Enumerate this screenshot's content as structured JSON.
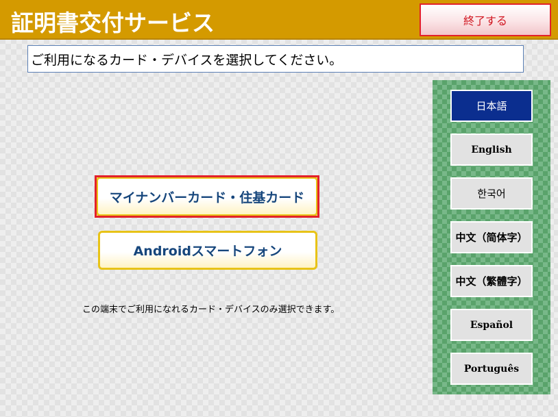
{
  "header": {
    "title": "証明書交付サービス",
    "exit_label": "終了する"
  },
  "instruction": "ご利用になるカード・デバイスを選択してください。",
  "devices": [
    {
      "label": "マイナンバーカード・住基カード",
      "selected": true
    },
    {
      "label": "Androidスマートフォン",
      "selected": false
    }
  ],
  "note": "この端末でご利用になれるカード・デバイスのみ選択できます。",
  "languages": [
    {
      "label": "日本語",
      "active": true
    },
    {
      "label": "English",
      "active": false
    },
    {
      "label": "한국어",
      "active": false
    },
    {
      "label": "中文（简体字）",
      "active": false
    },
    {
      "label": "中文（繁體字）",
      "active": false
    },
    {
      "label": "Español",
      "active": false
    },
    {
      "label": "Português",
      "active": false
    }
  ],
  "colors": {
    "header": "#d49a00",
    "exit_border": "#e3202a",
    "language_active": "#0b2e8f",
    "language_panel": "#5aa36b",
    "device_border": "#e8c317",
    "device_text": "#16467c",
    "selection_frame": "#e3202a"
  }
}
